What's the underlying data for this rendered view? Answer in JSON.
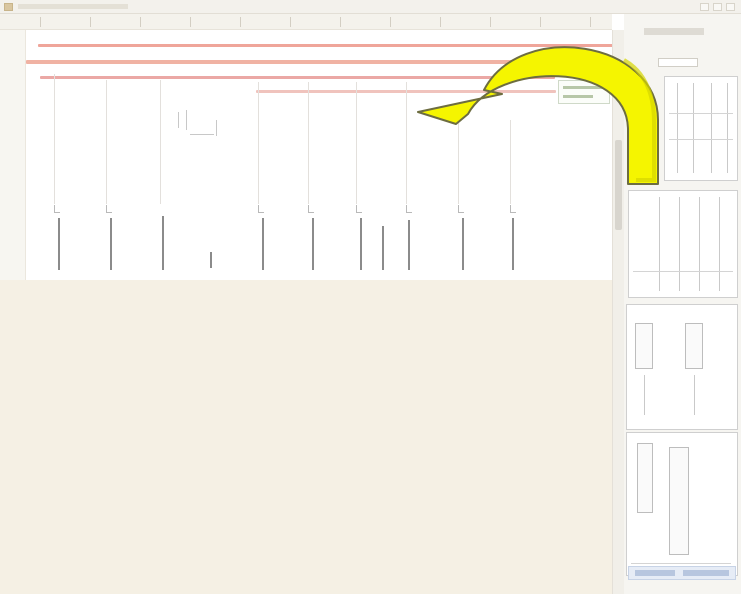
{
  "window": {
    "icons": [
      "app-icon",
      "minimize-icon",
      "maximize-icon",
      "close-icon"
    ]
  },
  "annotation": {
    "arrow_icon": "curved-arrow-icon",
    "arrow_fill": "#f5f500",
    "arrow_outline": "#6d6d40"
  },
  "colors": {
    "canvas_background": "#ffffff",
    "lower_area": "#f5f0e4",
    "timeline_bar": "#efa59a",
    "side_panel": "#f6f5f1",
    "track_marker": "#8b8b8b"
  }
}
